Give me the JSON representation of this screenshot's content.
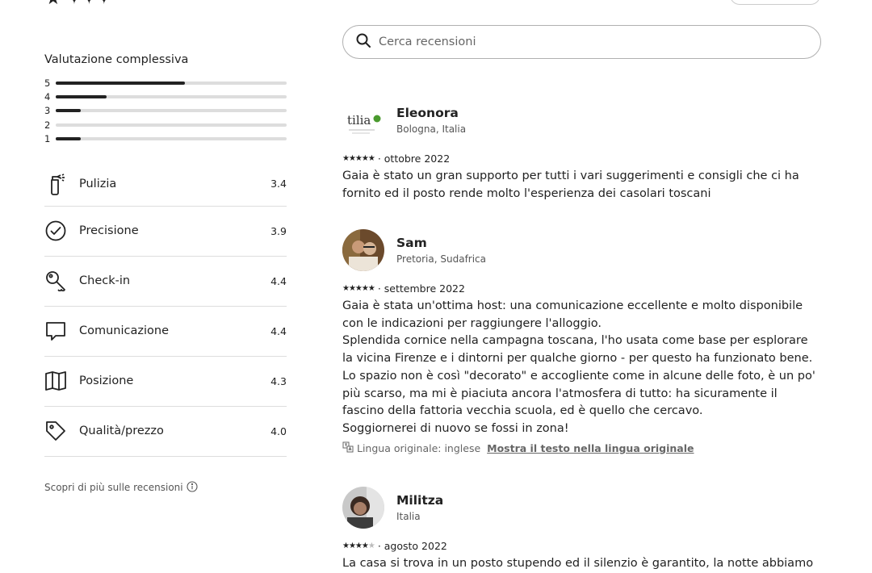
{
  "top": {
    "partial_text": "★ ✦✦✦"
  },
  "overall": {
    "title": "Valutazione complessiva",
    "histogram": [
      {
        "star": "5",
        "fraction": 0.56
      },
      {
        "star": "4",
        "fraction": 0.22
      },
      {
        "star": "3",
        "fraction": 0.11
      },
      {
        "star": "2",
        "fraction": 0.0
      },
      {
        "star": "1",
        "fraction": 0.11
      }
    ]
  },
  "categories": [
    {
      "icon": "spray-bottle-icon",
      "label": "Pulizia",
      "score": "3.4"
    },
    {
      "icon": "check-circle-icon",
      "label": "Precisione",
      "score": "3.9"
    },
    {
      "icon": "key-icon",
      "label": "Check-in",
      "score": "4.4"
    },
    {
      "icon": "chat-bubble-icon",
      "label": "Comunicazione",
      "score": "4.4"
    },
    {
      "icon": "map-icon",
      "label": "Posizione",
      "score": "4.3"
    },
    {
      "icon": "price-tag-icon",
      "label": "Qualità/prezzo",
      "score": "4.0"
    }
  ],
  "learn_more": "Scopri di più sulle recensioni",
  "search": {
    "placeholder": "Cerca recensioni"
  },
  "reviews": [
    {
      "name": "Eleonora",
      "location": "Bologna, Italia",
      "rating": 5,
      "date": "· ottobre 2022",
      "text": "Gaia è stato un gran supporto per tutti i vari suggerimenti e consigli che ci ha fornito ed il posto rende molto l'esperienza dei casolari toscani",
      "avatar_text": "tilia"
    },
    {
      "name": "Sam",
      "location": "Pretoria, Sudafrica",
      "rating": 5,
      "date": "· settembre 2022",
      "text": "Gaia è stata un'ottima host: una comunicazione eccellente e molto disponibile con le indicazioni per raggiungere l'alloggio.\nSplendida cornice nella campagna toscana, l'ho usata come base per esplorare la vicina Firenze e i dintorni per qualche giorno - per questo ha funzionato bene. Lo spazio non è così \"decorato\" e accogliente come in alcune delle foto, è un po' più scarso, ma mi è piaciuta ancora l'atmosfera di tutto: ha sicuramente il fascino della fattoria vecchia scuola, ed è quello che cercavo.\nSoggiornerei di nuovo se fossi in zona!",
      "original_language": "Lingua originale: inglese",
      "show_original": "Mostra il testo nella lingua originale"
    },
    {
      "name": "Militza",
      "location": "Italia",
      "rating": 4,
      "date": "· agosto 2022",
      "text": "La casa si trova in un posto stupendo ed il silenzio è garantito, la notte abbiamo"
    }
  ]
}
